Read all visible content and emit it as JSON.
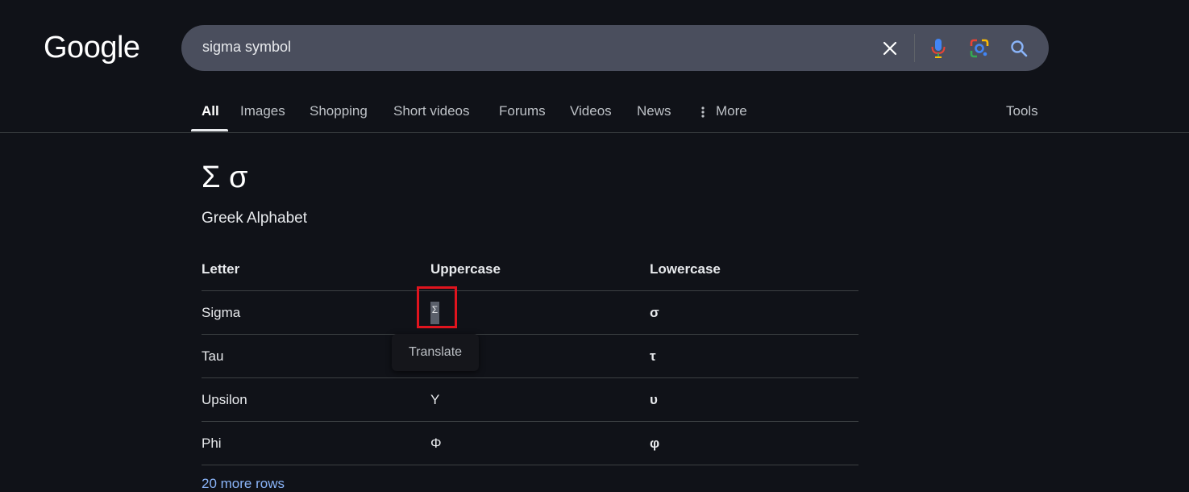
{
  "logo": "Google",
  "search": {
    "query": "sigma symbol"
  },
  "tabs": [
    {
      "label": "All",
      "active": true
    },
    {
      "label": "Images"
    },
    {
      "label": "Shopping"
    },
    {
      "label": "Short videos"
    },
    {
      "label": "Forums"
    },
    {
      "label": "Videos"
    },
    {
      "label": "News"
    },
    {
      "label": "More"
    }
  ],
  "tools_label": "Tools",
  "result": {
    "symbols": "Σ σ",
    "subtitle": "Greek Alphabet",
    "table": {
      "headers": [
        "Letter",
        "Uppercase",
        "Lowercase"
      ],
      "rows": [
        [
          "Sigma",
          "Σ",
          "σ"
        ],
        [
          "Tau",
          "",
          "τ"
        ],
        [
          "Upsilon",
          "Υ",
          "υ"
        ],
        [
          "Phi",
          "Φ",
          "φ"
        ]
      ]
    },
    "more_rows": "20 more rows"
  },
  "tooltip": "Translate",
  "colors": {
    "background": "#101218",
    "search_bg": "#4a4e5d",
    "link": "#8ab4f8",
    "highlight": "#e0141e"
  },
  "icons": [
    "clear-icon",
    "mic-icon",
    "lens-icon",
    "search-icon",
    "more-vert-icon"
  ]
}
